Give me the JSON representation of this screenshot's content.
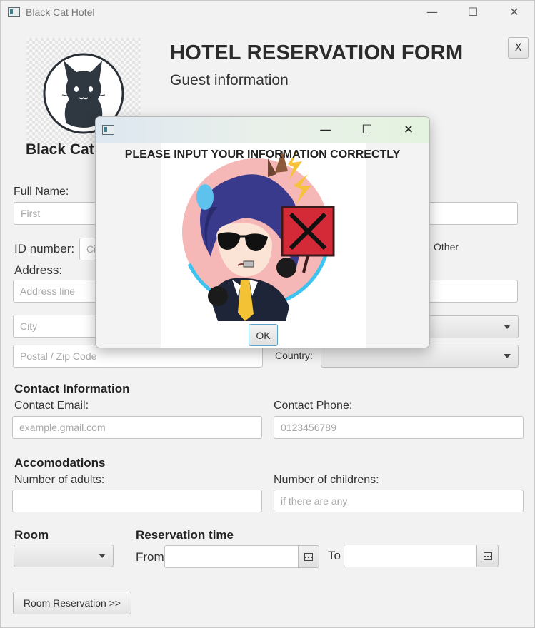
{
  "window": {
    "title": "Black Cat Hotel",
    "minimize_glyph": "—",
    "maximize_glyph": "☐",
    "close_glyph": "✕"
  },
  "header": {
    "close_button_label": "X",
    "hotel_name": "Black Cat Hotel",
    "form_title": "HOTEL RESERVATION FORM",
    "form_subtitle": "Guest information"
  },
  "guest": {
    "full_name_label": "Full Name:",
    "first_placeholder": "First",
    "id_label": "ID number:",
    "id_placeholder": "Ci",
    "gender_other_label": "Other",
    "address_label": "Address:",
    "address_placeholder": "Address line",
    "city_placeholder": "City",
    "postal_placeholder": "Postal / Zip Code",
    "country_label": "Country:"
  },
  "contact": {
    "section_title": "Contact Information",
    "email_label": "Contact Email:",
    "email_placeholder": "example.gmail.com",
    "phone_label": "Contact Phone:",
    "phone_placeholder": "0123456789"
  },
  "accommodations": {
    "section_title": "Accomodations",
    "adults_label": "Number of adults:",
    "children_label": "Number of childrens:",
    "children_placeholder": "if there are any"
  },
  "room": {
    "section_title": "Room",
    "reservation_title": "Reservation time",
    "from_label": "From",
    "to_label": "To",
    "submit_label": "Room Reservation >>"
  },
  "dialog": {
    "message": "PLEASE INPUT YOUR INFORMATION CORRECTLY",
    "ok_label": "OK",
    "minimize_glyph": "—",
    "maximize_glyph": "☐",
    "close_glyph": "✕"
  },
  "icons": {
    "cat_logo": "black-cat-logo",
    "dialog_image": "anime-girl-with-x-sign",
    "calendar": "calendar-icon"
  },
  "colors": {
    "accent_focus": "#5aa4c8",
    "window_bg": "#f2f2f2",
    "dialog_title_gradient": "#e4f3df"
  }
}
